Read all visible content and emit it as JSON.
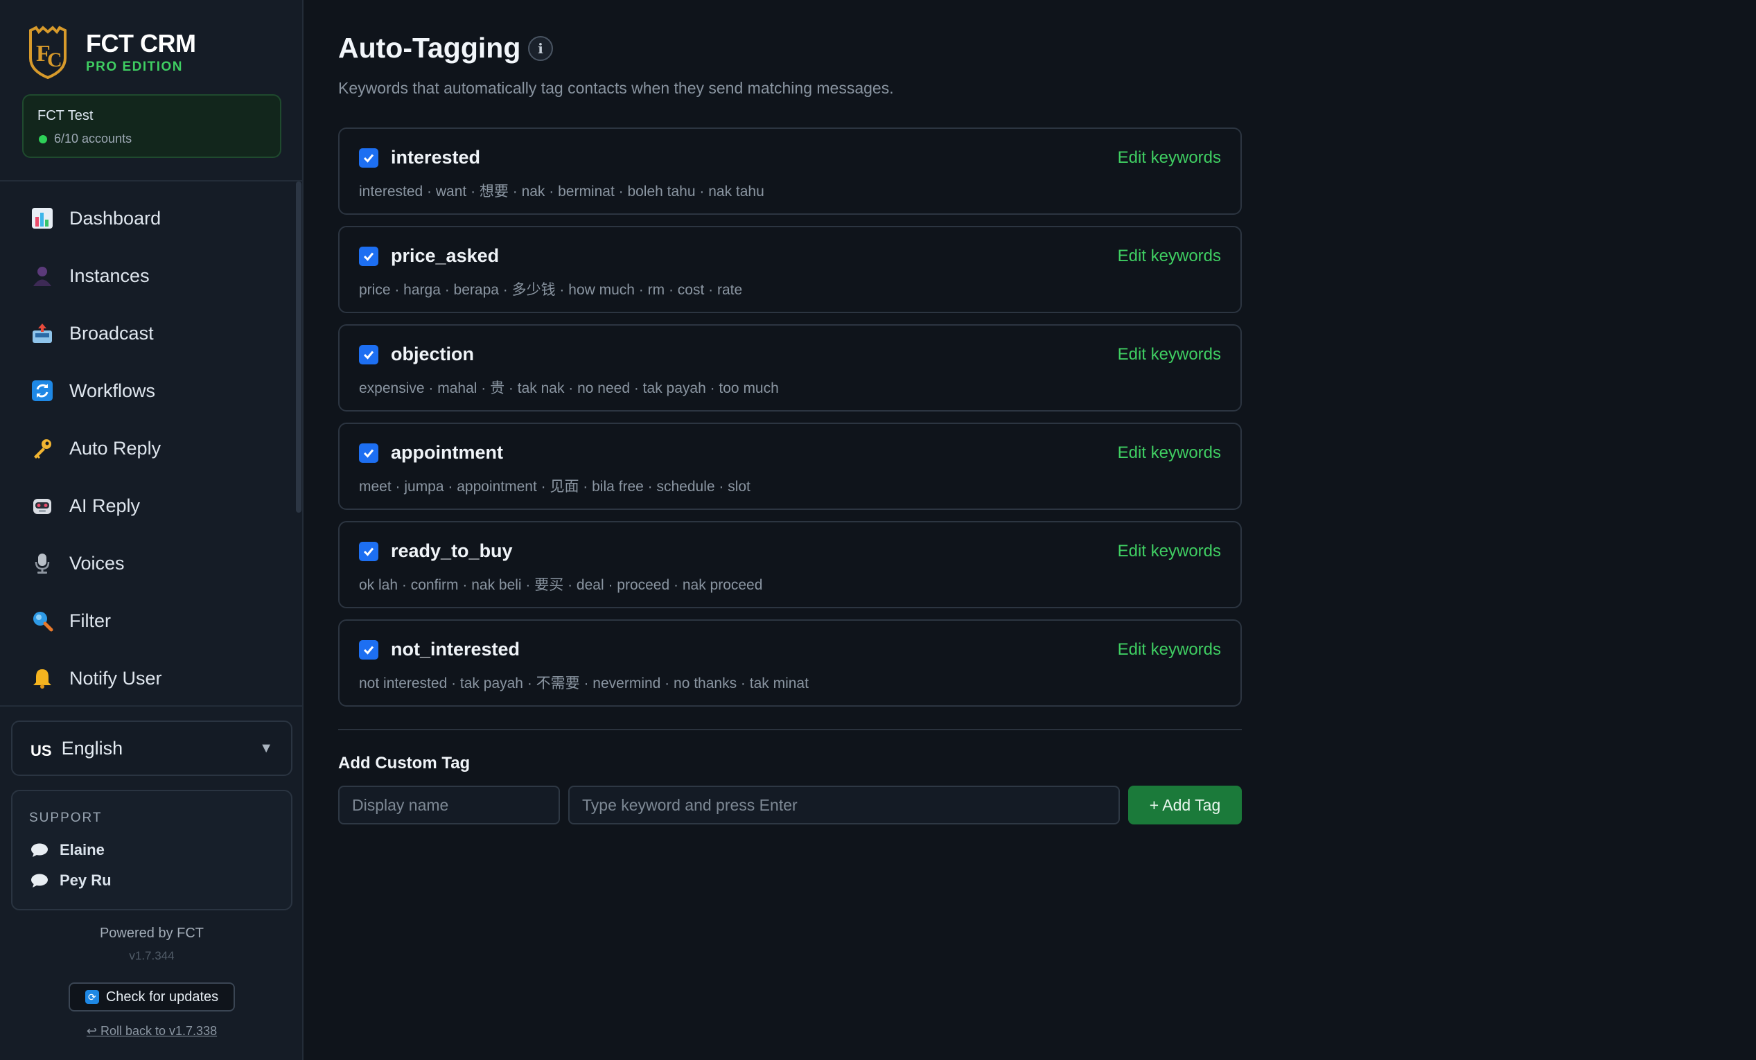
{
  "brand": {
    "name": "FCT CRM",
    "edition": "PRO EDITION"
  },
  "account": {
    "name": "FCT Test",
    "status": "6/10 accounts"
  },
  "nav": [
    {
      "label": "Dashboard",
      "icon": "bar-chart-icon"
    },
    {
      "label": "Instances",
      "icon": "user-icon"
    },
    {
      "label": "Broadcast",
      "icon": "outbox-icon"
    },
    {
      "label": "Workflows",
      "icon": "refresh-icon"
    },
    {
      "label": "Auto Reply",
      "icon": "key-icon"
    },
    {
      "label": "AI Reply",
      "icon": "robot-icon"
    },
    {
      "label": "Voices",
      "icon": "microphone-icon"
    },
    {
      "label": "Filter",
      "icon": "magnifier-icon"
    },
    {
      "label": "Notify User",
      "icon": "bell-icon"
    }
  ],
  "language": {
    "code": "US",
    "label": "English",
    "caret": "▼"
  },
  "support": {
    "title": "SUPPORT",
    "contacts": [
      "Elaine",
      "Pey Ru"
    ]
  },
  "footer": {
    "powered": "Powered by FCT",
    "version": "v1.7.344",
    "update_label": "Check for updates",
    "rollback_label": "↩ Roll back to v1.7.338"
  },
  "page": {
    "title": "Auto-Tagging",
    "info": "i",
    "subtitle": "Keywords that automatically tag contacts when they send matching messages."
  },
  "tags": [
    {
      "name": "interested",
      "checked": true,
      "edit_label": "Edit keywords",
      "keywords": "interested · want · 想要 · nak · berminat · boleh tahu · nak tahu"
    },
    {
      "name": "price_asked",
      "checked": true,
      "edit_label": "Edit keywords",
      "keywords": "price · harga · berapa · 多少钱 · how much · rm · cost · rate"
    },
    {
      "name": "objection",
      "checked": true,
      "edit_label": "Edit keywords",
      "keywords": "expensive · mahal · 贵 · tak nak · no need · tak payah · too much"
    },
    {
      "name": "appointment",
      "checked": true,
      "edit_label": "Edit keywords",
      "keywords": "meet · jumpa · appointment · 见面 · bila free · schedule · slot"
    },
    {
      "name": "ready_to_buy",
      "checked": true,
      "edit_label": "Edit keywords",
      "keywords": "ok lah · confirm · nak beli · 要买 · deal · proceed · nak proceed"
    },
    {
      "name": "not_interested",
      "checked": true,
      "edit_label": "Edit keywords",
      "keywords": "not interested · tak payah · 不需要 · nevermind · no thanks · tak minat"
    }
  ],
  "custom_tag": {
    "title": "Add Custom Tag",
    "name_placeholder": "Display name",
    "keyword_placeholder": "Type keyword and press Enter",
    "add_label": "+ Add Tag"
  },
  "colors": {
    "accent": "#3fce62",
    "checkbox": "#1d6ff2",
    "add_button": "#1b7a3a"
  }
}
